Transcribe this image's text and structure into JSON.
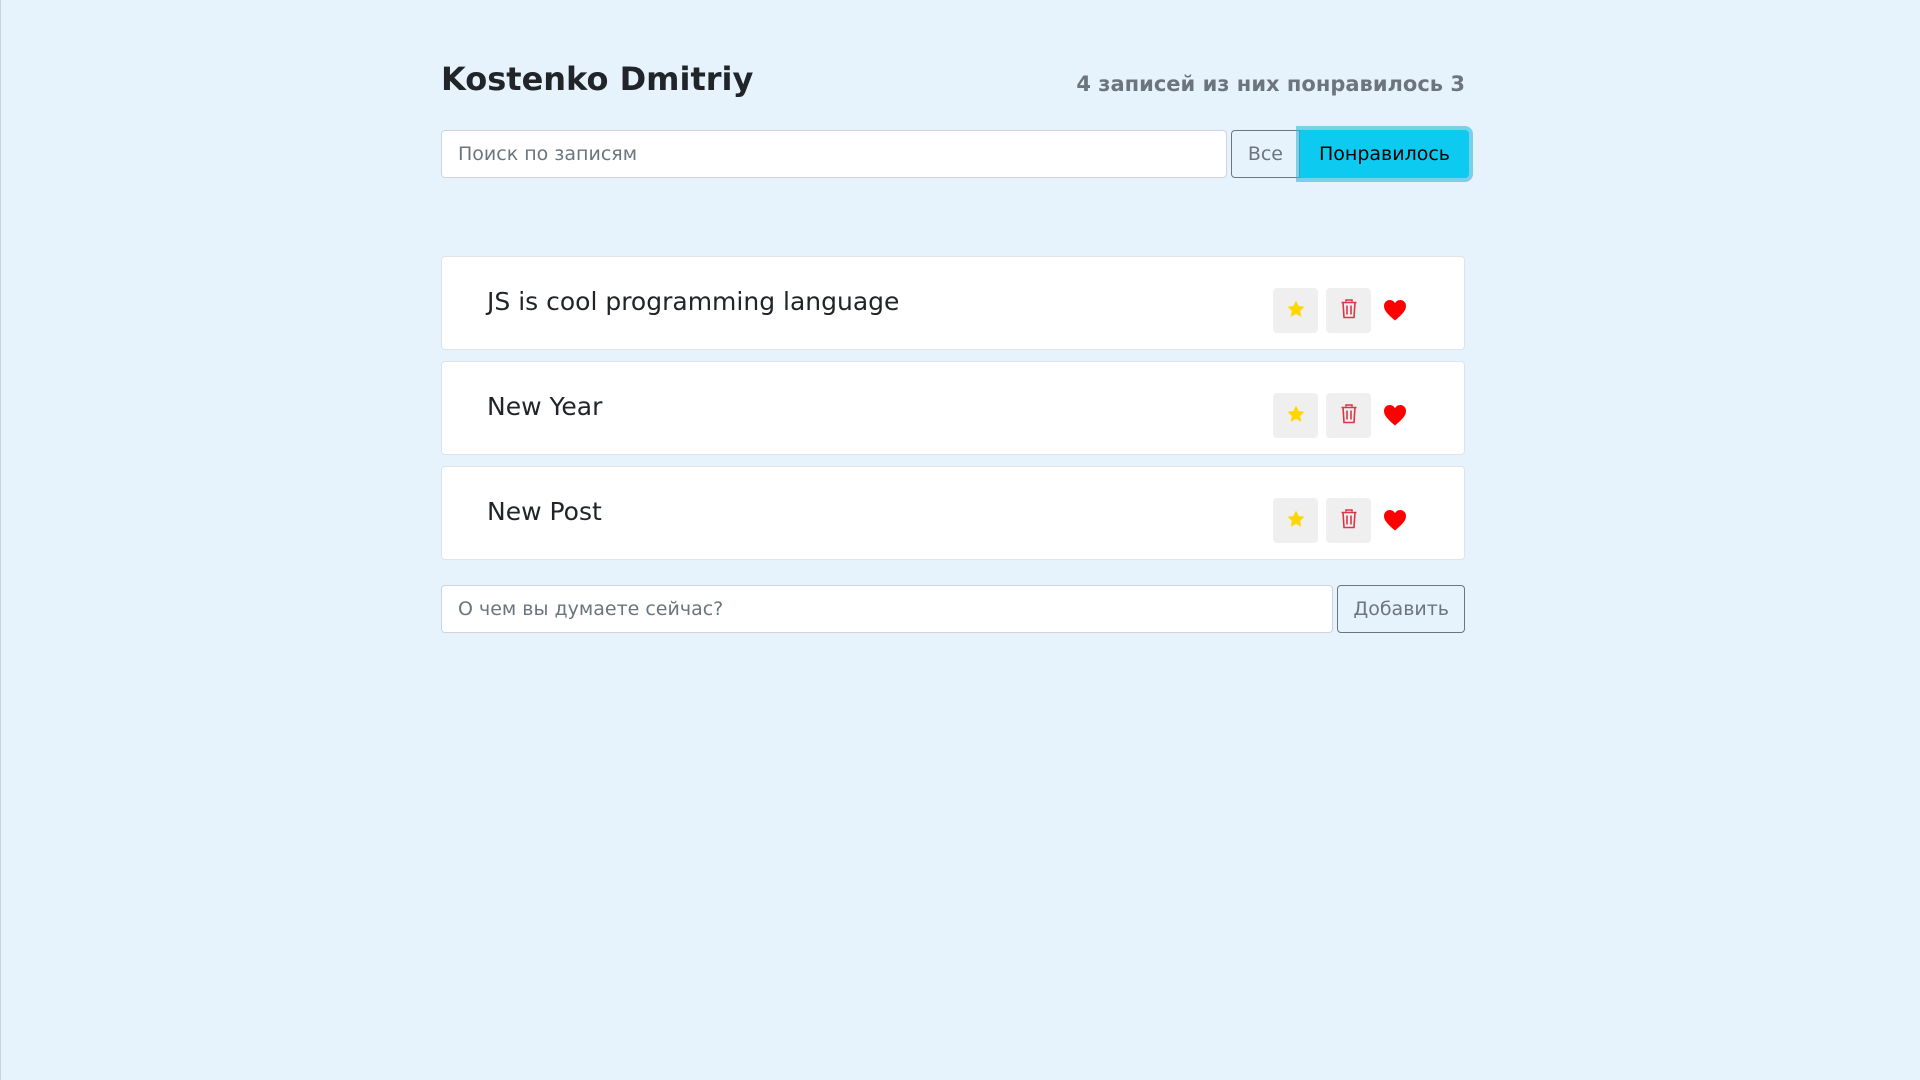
{
  "header": {
    "title": "Kostenko Dmitriy",
    "stats": "4 записей из них понравилось 3"
  },
  "search": {
    "placeholder": "Поиск по записям",
    "value": ""
  },
  "filter": {
    "all_label": "Все",
    "liked_label": "Понравилось",
    "active": "liked"
  },
  "posts": [
    {
      "label": "JS is cool programming language",
      "important": true,
      "liked": true
    },
    {
      "label": "New Year",
      "important": true,
      "liked": true
    },
    {
      "label": "New Post",
      "important": true,
      "liked": true
    }
  ],
  "add_form": {
    "placeholder": "О чем вы думаете сейчас?",
    "value": "",
    "button_label": "Добавить"
  },
  "icons": {
    "star": "star-icon",
    "trash": "trash-icon",
    "heart": "heart-icon"
  },
  "colors": {
    "background": "#e6f3fc",
    "accent": "#0dcaf0",
    "star": "#ffd700",
    "trash": "#dc3545",
    "heart": "#ff0000"
  }
}
